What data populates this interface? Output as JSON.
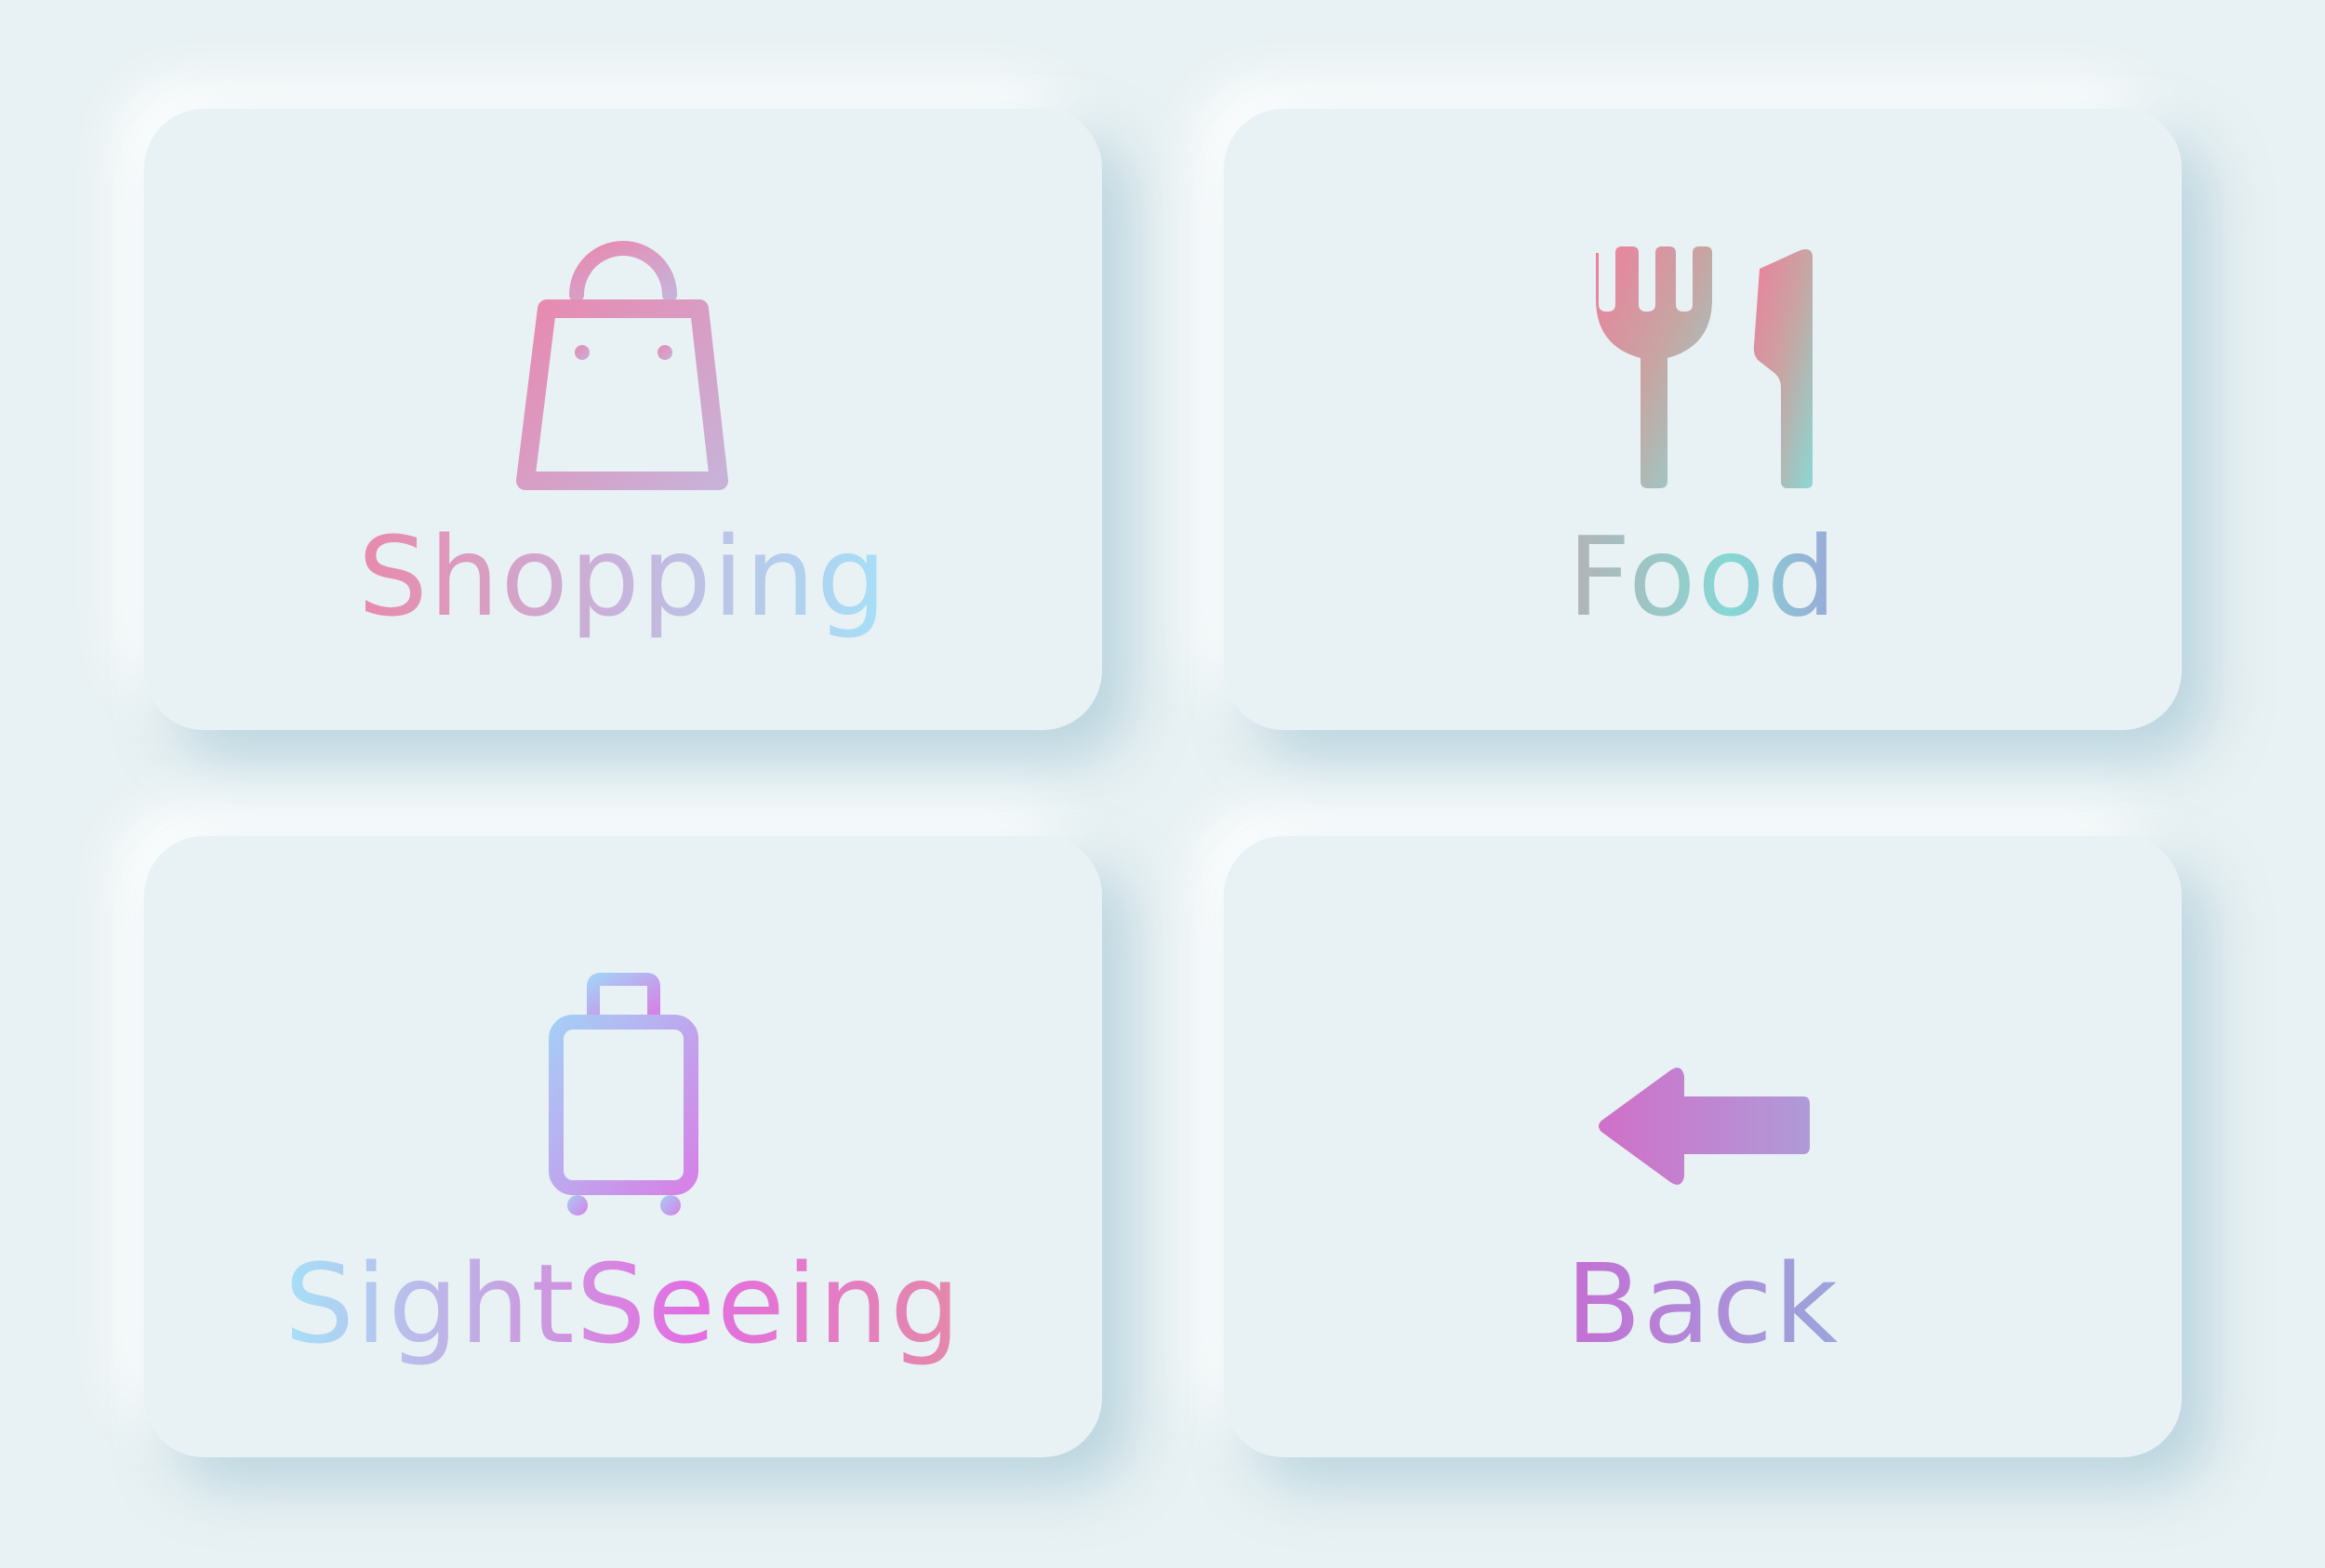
{
  "colors": {
    "background": "#e8f1f3",
    "pink": "#e88fb3",
    "purple": "#c18ad2",
    "lightblue": "#a6dcf6",
    "teal": "#8ed8d3",
    "magenta": "#e26ee0",
    "violet": "#c36fd4"
  },
  "cards": [
    {
      "label": "Shopping",
      "icon": "shopping-bag-icon"
    },
    {
      "label": "Food",
      "icon": "fork-knife-icon"
    },
    {
      "label": "SightSeeing",
      "icon": "suitcase-icon"
    },
    {
      "label": "Back",
      "icon": "arrow-left-icon"
    }
  ]
}
